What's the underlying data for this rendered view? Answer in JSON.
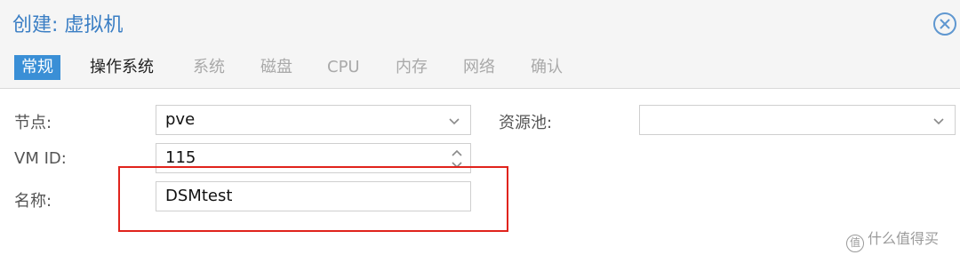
{
  "window": {
    "title": "创建: 虚拟机"
  },
  "tabs": [
    {
      "label": "常规",
      "state": "active"
    },
    {
      "label": "操作系统",
      "state": "enabled"
    },
    {
      "label": "系统",
      "state": "disabled"
    },
    {
      "label": "磁盘",
      "state": "disabled"
    },
    {
      "label": "CPU",
      "state": "disabled"
    },
    {
      "label": "内存",
      "state": "disabled"
    },
    {
      "label": "网络",
      "state": "disabled"
    },
    {
      "label": "确认",
      "state": "disabled"
    }
  ],
  "form": {
    "node": {
      "label": "节点:",
      "value": "pve"
    },
    "vmid": {
      "label": "VM ID:",
      "value": "115"
    },
    "name": {
      "label": "名称:",
      "value": "DSMtest"
    },
    "pool": {
      "label": "资源池:",
      "value": ""
    }
  },
  "colors": {
    "accent": "#3a8fd6",
    "title": "#3a7ec4",
    "highlight_box": "#e0231c"
  },
  "watermark": {
    "badge": "值",
    "text": "什么值得买"
  }
}
